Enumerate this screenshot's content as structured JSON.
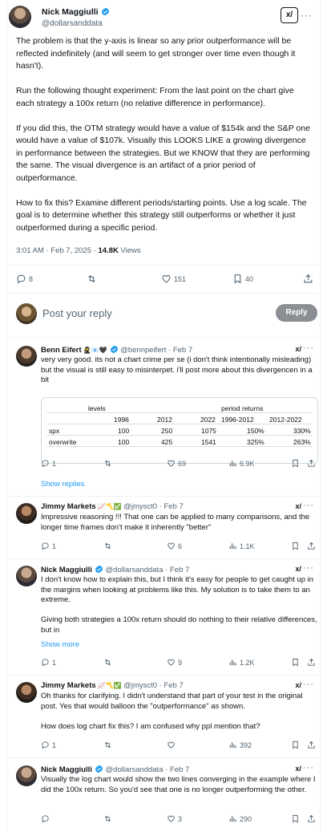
{
  "main_post": {
    "author": "Nick Maggiulli",
    "handle": "@dollarsanddata",
    "grok": "x/",
    "more": "···",
    "paragraphs": [
      "The problem is that the y-axis is linear so any prior  outperformance will be reflected indefinitely (and will seem to get stronger over time even though it hasn't).",
      "Run the following thought experiment: From the last point on the chart give each strategy a 100x return (no relative difference in performance).",
      "If you did this, the OTM strategy would have a value of $154k and the S&P one would have a value of $107k. Visually this LOOKS LIKE a growing divergence in performance between the strategies. But we KNOW that they are performing the same. The visual divergence is an artifact of a prior period of outperformance.",
      "How to fix this? Examine different periods/starting points. Use a log scale. The goal is to determine whether this strategy still outperforms or whether it just outperformed during a specific period."
    ],
    "timestamp": "3:01 AM · Feb 7, 2025 · ",
    "views_count": "14.8K",
    "views_label": " Views",
    "actions": {
      "replies": "8",
      "retweets": "",
      "likes": "151",
      "bookmarks": "40"
    }
  },
  "reply_box": {
    "placeholder": "Post your reply",
    "button": "Reply"
  },
  "replies": [
    {
      "author": "Benn Eifert",
      "emojis": "🥷📧🖤",
      "handle": "@bennpeifert",
      "time": "· Feb 7",
      "paragraphs": [
        "very very good. its not a chart crime per se (i don't think intentionally misleading) but the visual is still easy to misinterpet. i'll post more about this divergencen in a bit"
      ],
      "table": {
        "group_left": "levels",
        "group_right": "period returns",
        "columns": [
          "1996",
          "2012",
          "2022",
          "1996-2012",
          "2012-2022"
        ],
        "rows": [
          {
            "label": "spx",
            "values": [
              "100",
              "250",
              "1075",
              "150%",
              "330%"
            ]
          },
          {
            "label": "overwrite",
            "values": [
              "100",
              "425",
              "1541",
              "325%",
              "263%"
            ]
          }
        ]
      },
      "actions": {
        "replies": "1",
        "retweets": "",
        "likes": "69",
        "views": "6.9K"
      },
      "link": "Show replies"
    },
    {
      "author": "Jimmy Markets",
      "emojis": "📈〽️✅",
      "handle": "@jmysct0",
      "time": "· Feb 7",
      "paragraphs": [
        "Impressive reasoning !!! That  one can be applied to many comparisons, and the longer time frames don't make it inherently \"better\""
      ],
      "actions": {
        "replies": "1",
        "retweets": "",
        "likes": "6",
        "views": "1.1K"
      }
    },
    {
      "author": "Nick Maggiulli",
      "handle": "@dollarsanddata",
      "time": "· Feb 7",
      "paragraphs": [
        "I don't know how to explain this, but I think it's easy for people to get caught up in the margins when looking at problems like this. My solution is to take them to an extreme.",
        "Giving both strategies a 100x return should do nothing to their relative differences, but in"
      ],
      "link": "Show more",
      "actions": {
        "replies": "1",
        "retweets": "",
        "likes": "9",
        "views": "1.2K"
      }
    },
    {
      "author": "Jimmy Markets",
      "emojis": "📈〽️✅",
      "handle": "@jmysct0",
      "time": "· Feb 7",
      "paragraphs": [
        "Oh thanks for clarifying. I didn't understand that part of your test in the original post. Yes that would balloon the \"outperformance\" as shown.",
        "How does log chart fix this? I am confused why ppl mention that?"
      ],
      "actions": {
        "replies": "1",
        "retweets": "",
        "likes": "",
        "views": "392"
      }
    },
    {
      "author": "Nick Maggiulli",
      "handle": "@dollarsanddata",
      "time": "· Feb 7",
      "paragraphs": [
        "Visually the log chart would show the two lines converging in the example where I did the 100x return. So you'd see that one is no longer outperforming the other."
      ],
      "actions": {
        "replies": "",
        "retweets": "",
        "likes": "3",
        "views": "290"
      }
    }
  ],
  "icons": [
    "verified-badge-icon",
    "reply-icon",
    "retweet-icon",
    "like-icon",
    "views-icon",
    "bookmark-icon",
    "share-icon",
    "grok-icon",
    "more-icon"
  ],
  "colors": {
    "accent": "#1d9bf0",
    "muted": "#536471",
    "reply_button": "#8b8f93"
  }
}
